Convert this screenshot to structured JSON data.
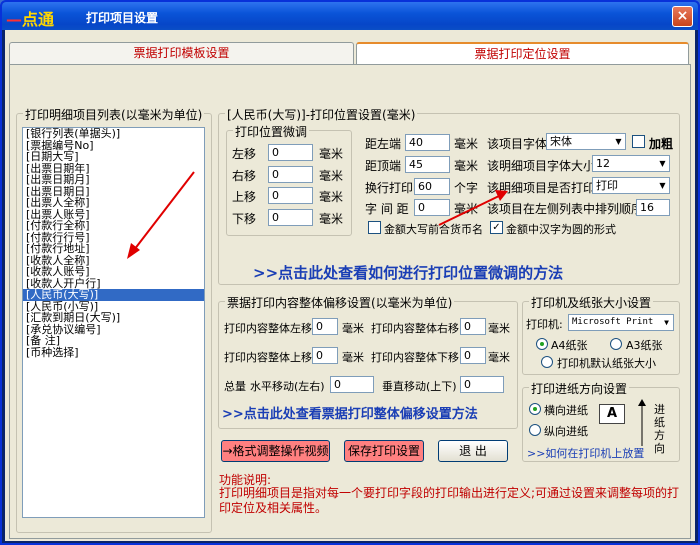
{
  "window": {
    "logo": "点通",
    "logo_dash": "—",
    "title": "打印项目设置",
    "close": "×"
  },
  "tabs": [
    {
      "label": "票据打印模板设置"
    },
    {
      "label": "票据打印定位设置"
    }
  ],
  "item_list": {
    "label": "打印明细项目列表(以毫米为单位)",
    "items": [
      "[银行列表(单据头)]",
      "[票据编号No]",
      "[日期大写]",
      "[出票日期年]",
      "[出票日期月]",
      "[出票日期日]",
      "[出票人全称]",
      "[出票人账号]",
      "[付款行全称]",
      "[付款行行号]",
      "[付款行地址]",
      "[收款人全称]",
      "[收款人账号]",
      "[收款人开户行]",
      "[人民币(大写)]",
      "[人民币(小写)]",
      "[汇款到期日(大写)]",
      "[承兑协议编号]",
      "[备    注]",
      "[币种选择]"
    ],
    "selected_index": 14
  },
  "position": {
    "group_label": "[人民币(大写)]-打印位置设置(毫米)",
    "fine_tune_label": "打印位置微调",
    "fine": [
      {
        "label": "左移",
        "value": "0",
        "unit": "毫米"
      },
      {
        "label": "右移",
        "value": "0",
        "unit": "毫米"
      },
      {
        "label": "上移",
        "value": "0",
        "unit": "毫米"
      },
      {
        "label": "下移",
        "value": "0",
        "unit": "毫米"
      }
    ],
    "left_margin": {
      "label": "距左端",
      "value": "40",
      "unit": "毫米"
    },
    "top_margin": {
      "label": "距顶端",
      "value": "45",
      "unit": "毫米"
    },
    "wrap": {
      "label": "换行打印",
      "value": "60",
      "unit": "个字"
    },
    "spacing": {
      "label": "字 间 距",
      "value": "0",
      "unit": "毫米"
    },
    "font": {
      "label": "该项目字体",
      "value": "宋体"
    },
    "bold": {
      "label": "加粗",
      "checked": false
    },
    "font_size": {
      "label": "该明细项目字体大小",
      "value": "12"
    },
    "print_flag": {
      "label": "该明细项目是否打印",
      "value": "打印"
    },
    "order": {
      "label": "该项目在左侧列表中排列顺序",
      "value": "16"
    },
    "currency_check": {
      "label": "金额大写前合货币名",
      "checked": false
    },
    "circle_check": {
      "label": "金额中汉字为圆的形式",
      "checked": true
    },
    "help_link": ">>点击此处查看如何进行打印位置微调的方法"
  },
  "offset": {
    "group_label": "票据打印内容整体偏移设置(以毫米为单位)",
    "left": {
      "label": "打印内容整体左移",
      "value": "0",
      "unit": "毫米"
    },
    "right": {
      "label": "打印内容整体右移",
      "value": "0",
      "unit": "毫米"
    },
    "up": {
      "label": "打印内容整体上移",
      "value": "0",
      "unit": "毫米"
    },
    "down": {
      "label": "打印内容整体下移",
      "value": "0",
      "unit": "毫米"
    },
    "total_label": "总量",
    "horiz": {
      "label": "水平移动(左右)",
      "value": "0"
    },
    "vert": {
      "label": "垂直移动(上下)",
      "value": "0"
    },
    "help_link": ">>点击此处查看票据打印整体偏移设置方法"
  },
  "printer": {
    "group_label": "打印机及纸张大小设置",
    "printer_label": "打印机:",
    "printer_value": "Microsoft Print",
    "paper": [
      {
        "label": "A4纸张",
        "checked": true
      },
      {
        "label": "A3纸张",
        "checked": false
      },
      {
        "label": "打印机默认纸张大小",
        "checked": false
      }
    ]
  },
  "feed": {
    "group_label": "打印进纸方向设置",
    "options": [
      {
        "label": "横向进纸",
        "checked": true
      },
      {
        "label": "纵向进纸",
        "checked": false
      }
    ],
    "paper_glyph": "A",
    "direction_text": "进纸方向",
    "help_link": ">>如何在打印机上放置"
  },
  "buttons": {
    "video": "→格式调整操作视频",
    "save": "保存打印设置",
    "exit": "退  出"
  },
  "notes": {
    "title": "功能说明:",
    "body": "打印明细项目是指对每一个要打印字段的打印输出进行定义;可通过设置来调整每项的打印定位及相关属性。"
  }
}
